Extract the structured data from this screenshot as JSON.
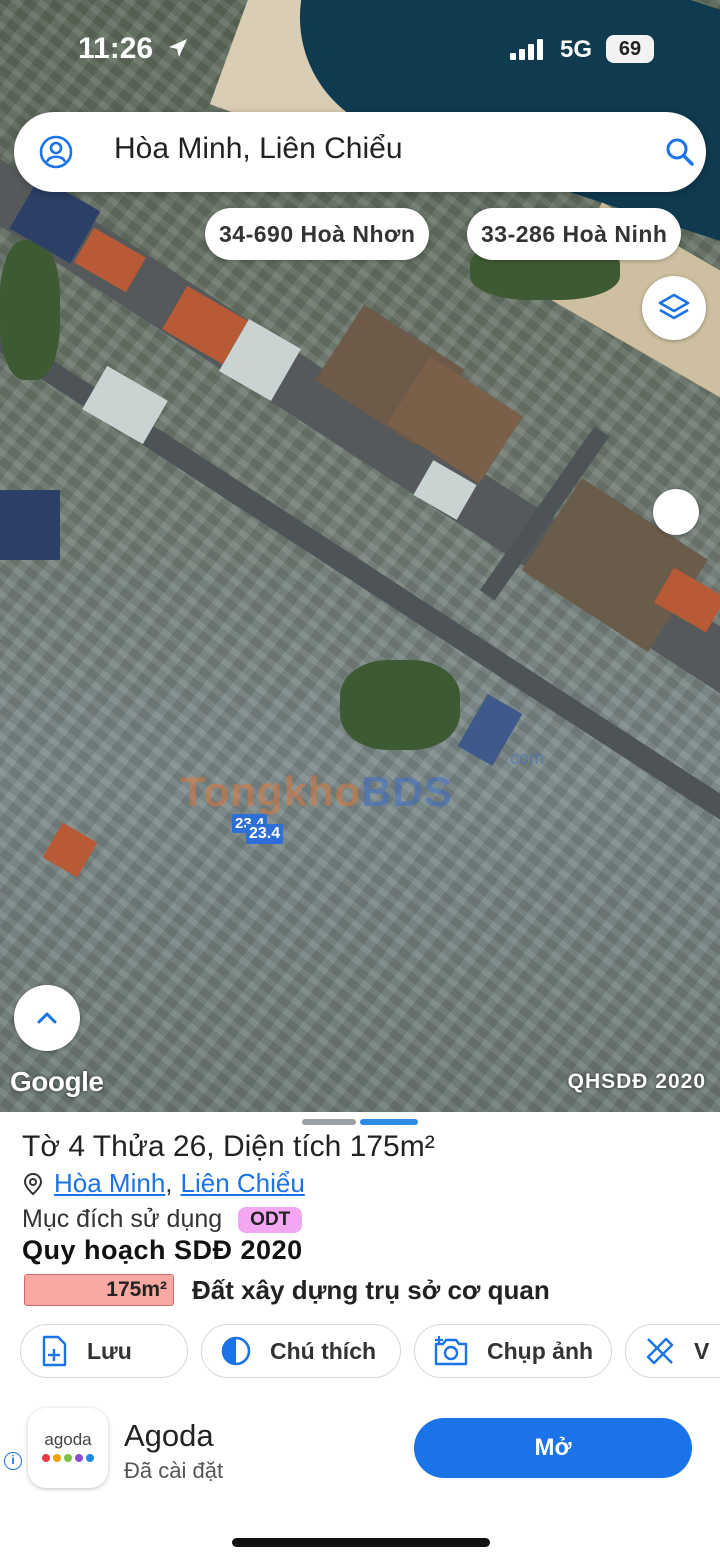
{
  "status_bar": {
    "time": "11:26",
    "network": "5G",
    "battery": "69"
  },
  "search": {
    "location_text": "Hòa Minh, Liên Chiểu"
  },
  "nearby_chips": [
    "34-690 Hoà Nhơn",
    "33-286 Hoà Ninh"
  ],
  "map": {
    "watermark_a": "Tongkho",
    "watermark_b": "BDS",
    "watermark_com": ".com",
    "elevation_a": "23.4",
    "elevation_b": "23.4",
    "google_label": "Google",
    "plan_layer_label": "QHSDĐ 2020"
  },
  "parcel": {
    "title": "Tờ 4 Thửa 26, Diện tích 175m²",
    "ward": "Hòa Minh",
    "district": "Liên Chiểu",
    "purpose_label": "Mục đích sử dụng",
    "purpose_code": "ODT",
    "plan_title": "Quy hoạch SDĐ 2020",
    "plan_area": "175m²",
    "plan_use": "Đất xây dựng trụ sở cơ quan"
  },
  "actions": [
    {
      "label": "Lưu",
      "icon": "file-plus-icon"
    },
    {
      "label": "Chú thích",
      "icon": "half-circle-icon"
    },
    {
      "label": "Chụp ảnh",
      "icon": "camera-plus-icon"
    },
    {
      "label": "V",
      "icon": "ruler-pencil-icon"
    }
  ],
  "ad": {
    "app_name": "Agoda",
    "status": "Đã cài đặt",
    "open_label": "Mở",
    "logo_word": "agoda",
    "logo_dot_colors": [
      "#e63946",
      "#f4a100",
      "#7cc242",
      "#8a4fd0",
      "#1e88e5"
    ]
  },
  "colors": {
    "accent": "#1a73e8",
    "badge": "#f3a6f2",
    "area_bar": "#f7a8a0"
  }
}
